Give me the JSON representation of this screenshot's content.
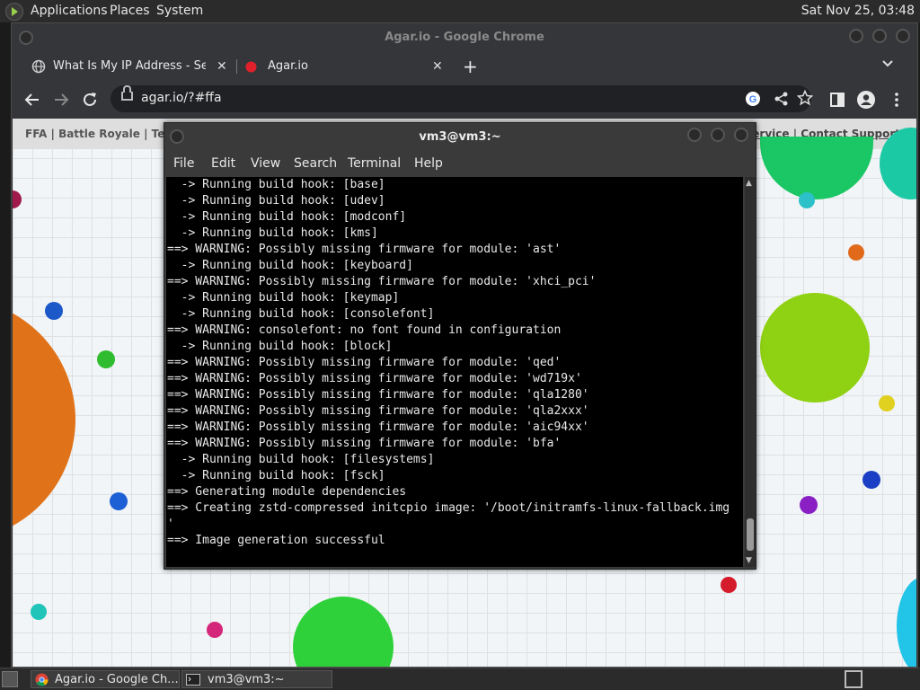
{
  "top_panel": {
    "menus": [
      "Applications",
      "Places",
      "System"
    ],
    "clock": "Sat Nov 25, 03:48"
  },
  "chrome": {
    "window_title": "Agar.io - Google Chrome",
    "tabs": [
      {
        "label": "What Is My IP Address - See Y"
      },
      {
        "label": "Agar.io"
      }
    ],
    "url": "agar.io/?#ffa"
  },
  "agar": {
    "nav_left": [
      "FFA",
      "Battle Royale",
      "Team"
    ],
    "nav_right": [
      "of Service",
      "Contact Support"
    ]
  },
  "terminal": {
    "title": "vm3@vm3:~",
    "menu": [
      "File",
      "Edit",
      "View",
      "Search",
      "Terminal",
      "Help"
    ],
    "lines": [
      "  -> Running build hook: [base]",
      "  -> Running build hook: [udev]",
      "  -> Running build hook: [modconf]",
      "  -> Running build hook: [kms]",
      "==> WARNING: Possibly missing firmware for module: 'ast'",
      "  -> Running build hook: [keyboard]",
      "==> WARNING: Possibly missing firmware for module: 'xhci_pci'",
      "  -> Running build hook: [keymap]",
      "  -> Running build hook: [consolefont]",
      "==> WARNING: consolefont: no font found in configuration",
      "  -> Running build hook: [block]",
      "==> WARNING: Possibly missing firmware for module: 'qed'",
      "==> WARNING: Possibly missing firmware for module: 'wd719x'",
      "==> WARNING: Possibly missing firmware for module: 'qla1280'",
      "==> WARNING: Possibly missing firmware for module: 'qla2xxx'",
      "==> WARNING: Possibly missing firmware for module: 'aic94xx'",
      "==> WARNING: Possibly missing firmware for module: 'bfa'",
      "  -> Running build hook: [filesystems]",
      "  -> Running build hook: [fsck]",
      "==> Generating module dependencies",
      "==> Creating zstd-compressed initcpio image: '/boot/initramfs-linux-fallback.img",
      "'",
      "==> Image generation successful"
    ]
  },
  "taskbar": {
    "items": [
      {
        "label": "Agar.io - Google Ch..."
      },
      {
        "label": "vm3@vm3:~"
      }
    ]
  },
  "colors": {
    "panel_bg": "#2b2b2b",
    "chrome_frame": "#35363a",
    "omnibox_bg": "#202124",
    "terminal_bg": "#000000",
    "terminal_fg": "#e8e8e8",
    "agar_tab_icon": "#e0212b"
  }
}
